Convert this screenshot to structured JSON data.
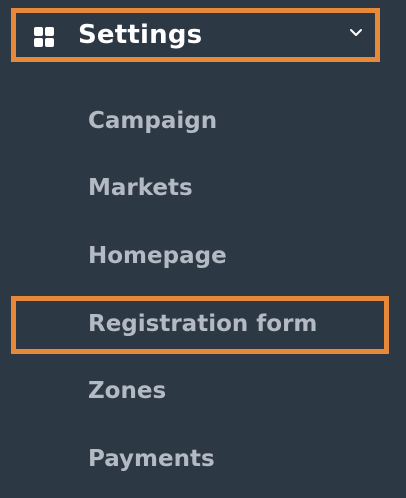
{
  "header": {
    "title": "Settings",
    "icon": "grid-icon",
    "chevron": "chevron-down-icon"
  },
  "menu": {
    "items": [
      {
        "label": "Campaign"
      },
      {
        "label": "Markets"
      },
      {
        "label": "Homepage"
      },
      {
        "label": "Registration form"
      },
      {
        "label": "Zones"
      },
      {
        "label": "Payments"
      }
    ]
  },
  "colors": {
    "background": "#2d3845",
    "highlight": "#e8893a",
    "header_text": "#ffffff",
    "item_text": "#b3bac4"
  }
}
